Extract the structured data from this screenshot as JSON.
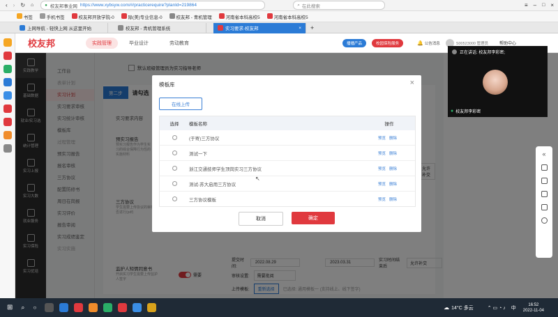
{
  "browser": {
    "url_site": "校友邦事业网",
    "url": "https://www.xybsyw.com/#/practicerequire?planId=219864",
    "search_placeholder": "在此搜索",
    "bookmarks": [
      "书签",
      "手机书签",
      "校友邦开放学院-0",
      "除(美)专业信息-0",
      "校友邦 - 青机管理",
      "河南省本科高校5",
      "河南省本科高校5"
    ],
    "tabs": [
      "上网导航 - 轻快上网 从这里开始",
      "校友邦 - 青机管理系统",
      "实习要求-校友邦"
    ]
  },
  "header": {
    "logo": "校友邦",
    "nav": [
      "实践管理",
      "毕业设计",
      "劳动教育"
    ],
    "pill1": "播播产品",
    "pill2": "校园保险服务",
    "notice": "公告消息",
    "user": "S00523000 管理员",
    "help": "帮助中心"
  },
  "sidenav": [
    "实践教学",
    "基础数据",
    "就业/实习选",
    "统计管理",
    "实习上报",
    "实习大数",
    "就业服务",
    "实习保险",
    "实习优培"
  ],
  "submenu": [
    "工作台",
    "表单计划",
    "实习计划",
    "实习要求审核",
    "实习统计审核",
    "模板库",
    "过程管理",
    "预实习报告",
    "报名审核",
    "三方协议",
    "配置防修书",
    "周日在岗报",
    "实习评价",
    "报告审阅",
    "实习成绩鉴定",
    "实习实施"
  ],
  "main": {
    "checkbox_label": "默认班级管理员为实习指导老师",
    "step": "第二步",
    "step_title": "请勾选",
    "col_content": "实习要求内容",
    "row_labels": [
      "预实习报告",
      "三方协议",
      "监护人知情同意书"
    ],
    "row_descs": [
      "预实习报告作为学生实习的综合保障行为性的实施材料",
      "学生需要上传协议的审核是否进行(pdf)",
      "开启实习学生需要上传监护人签字"
    ],
    "toggle_label": "需要",
    "submit_label": "提交时间:",
    "date_start": "2022.08.29",
    "date_end": "2023.03.31",
    "late_label": "实习时间结束后",
    "late_value": "允许补交",
    "review_label": "审核设置:",
    "review_value": "需要批阅",
    "upload_label": "上传模板:",
    "upload_btn": "重新选择",
    "upload_note": "已选择: 通用模板一 (支持线上、线下签字)"
  },
  "modal": {
    "title": "模板库",
    "upload_btn": "在线上传",
    "headers": [
      "选择",
      "模板名称",
      "操作"
    ],
    "rows": [
      "(于寄)三方协议",
      "测试一下",
      "浙江交通技师学生顶岗实习三方协议",
      "测试-苏大启用三方协议",
      "三方协议模板"
    ],
    "action_preview": "预览",
    "action_delete": "删除",
    "cancel": "取消",
    "confirm": "确定"
  },
  "video": {
    "title": "正在讲话: 校友邦李彩密;",
    "name": "校友邦李彩密"
  },
  "taskbar": {
    "weather": "14°C 多云",
    "ime": "中",
    "time": "16:52",
    "date": "2022-11-04"
  },
  "colors": {
    "brand_red": "#e0393e",
    "link_blue": "#3a7fd5",
    "tab_blue": "#2b7bd6",
    "taskbar": "#1f2a36"
  }
}
